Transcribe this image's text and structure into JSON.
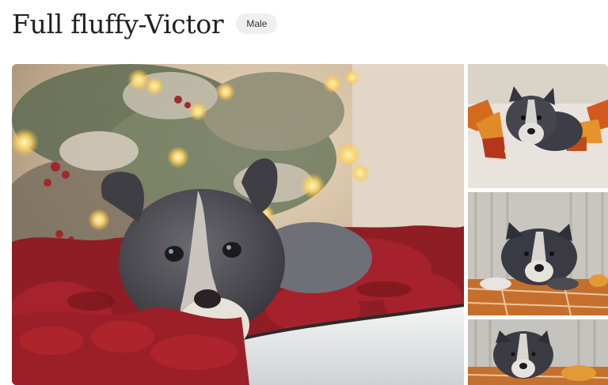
{
  "listing": {
    "title": "Full fluffy-Victor",
    "gender_badge": "Male"
  },
  "gallery": {
    "main_photo_alt": "Gray and white puppy on red knit blanket in front of Christmas tree",
    "thumbnails": [
      {
        "alt": "Puppy lying on blanket with autumn leaves"
      },
      {
        "alt": "Puppy on striped orange pillow"
      },
      {
        "alt": "Puppy close-up on striped pillow"
      }
    ]
  }
}
